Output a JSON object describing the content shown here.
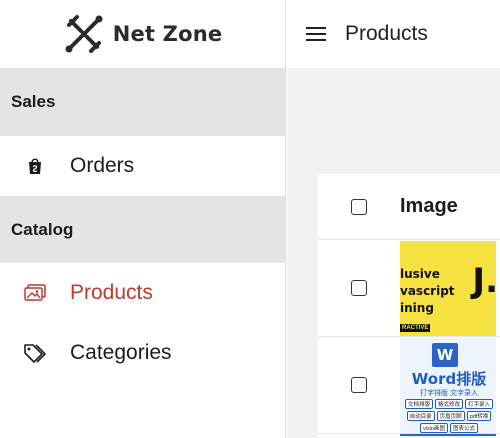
{
  "brand": {
    "name": "Net Zone",
    "accent": "#c0392b"
  },
  "sidebar": {
    "sections": [
      {
        "title": "Sales",
        "items": [
          {
            "label": "Orders",
            "icon": "shopping-bag-icon"
          }
        ]
      },
      {
        "title": "Catalog",
        "items": [
          {
            "label": "Products",
            "icon": "image-gallery-icon",
            "active": true
          },
          {
            "label": "Categories",
            "icon": "tags-icon"
          }
        ]
      }
    ]
  },
  "header": {
    "title": "Products",
    "menu_icon": "hamburger-menu-icon"
  },
  "table": {
    "columns": [
      "Image"
    ],
    "rows": [
      {
        "image": {
          "kind": "javascript-course-thumbnail",
          "lines": [
            "lusive",
            "vascript",
            "ining"
          ],
          "big_letter": "J.",
          "badge": "RACTIVE"
        }
      },
      {
        "image": {
          "kind": "word-course-thumbnail",
          "icon_letter": "W",
          "title": "Word排版",
          "subtitle": "打字排版 文字录入",
          "tags": [
            "文档排版",
            "格式修改",
            "打字录入",
            "自动目录",
            "页眉页脚",
            "pdf转换",
            "visio画图",
            "图表公式"
          ]
        }
      }
    ]
  }
}
